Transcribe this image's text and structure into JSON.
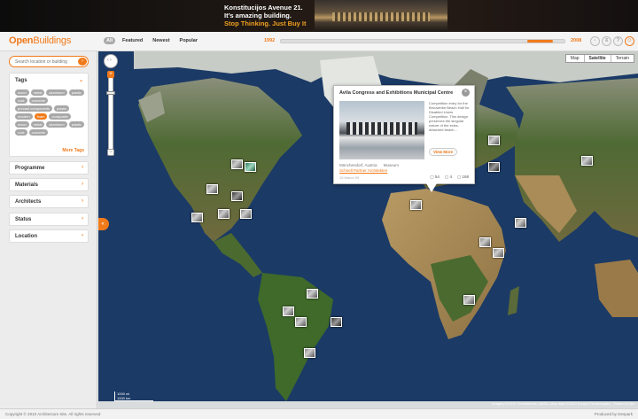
{
  "banner": {
    "line1": "Konstitucijos Avenue 21.",
    "line2": "It’s amazing building.",
    "line3": "Stop Thinking. Just Buy It"
  },
  "header": {
    "logo_part1": "Open",
    "logo_part2": "Buildings",
    "filters": [
      "All",
      "Featured",
      "Newest",
      "Popular"
    ],
    "year_start": "1992",
    "year_end": "2008",
    "timeline_selected_range": [
      0.87,
      0.96
    ],
    "icons": [
      "rss-icon",
      "share-icon",
      "help-icon",
      "user-icon"
    ]
  },
  "sidebar": {
    "search_placeholder": "Search location or building",
    "tags_title": "Tags",
    "tags": [
      "wood",
      "metal",
      "aluminum",
      "plastic",
      "rock",
      "concrete",
      "precast components",
      "plastic",
      "modern",
      "foam",
      "composite",
      "wood",
      "metal",
      "aluminum",
      "plastic",
      "rock",
      "concrete"
    ],
    "selected_tag": "foam",
    "more_tags": "More Tags",
    "sections": [
      "Programme",
      "Materials",
      "Architects",
      "Status",
      "Location"
    ]
  },
  "map": {
    "types": [
      "Map",
      "Satellite",
      "Terrain"
    ],
    "active_type": "Satellite",
    "scale_mi": "1000 mi",
    "scale_km": "1000 km",
    "imagery_credit": "Imagery ©2010 TerraMetrics, NASA, Map data ©2010 Europa Technologies - Terms of Use",
    "accent": "#f07a1a",
    "ocean": "#1b3a66",
    "land": "#5a6e3c"
  },
  "popup": {
    "title": "Avila Congress and Exhibitions Municipal Centre",
    "description": "Competition entry for the Brouwerke Beach Hall for Disabled Users Competition. This design preserves the singular nature of the extra-detached beach...",
    "button": "View More",
    "location": "Münchendorf, Austria",
    "type": "Museum",
    "architect": "Schnell Partner Architekten",
    "date": "15 March 09",
    "stat1": "54",
    "stat2": "4",
    "stat3": "168"
  },
  "footer": {
    "copyright": "Copyright © 2010 Architecture Site. All rights reserved",
    "produced": "Produced by Despark"
  }
}
